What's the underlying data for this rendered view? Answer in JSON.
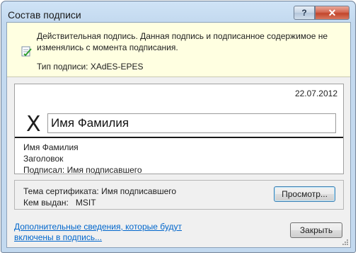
{
  "window": {
    "title": "Состав подписи",
    "help_button": "?",
    "close_button": "✕"
  },
  "info": {
    "message": "Действительная подпись. Данная подпись и подписанное содержимое не изменялись с момента подписания.",
    "signature_type": "Тип подписи: XAdES-EPES"
  },
  "signature": {
    "date": "22.07.2012",
    "x_mark": "X",
    "name_value": "Имя Фамилия",
    "signer_name": "Имя Фамилия",
    "signer_title": "Заголовок",
    "signed_by": "Подписал: Имя подписавшего"
  },
  "certificate": {
    "subject": "Тема сертификата: Имя подписавшего",
    "issued_by": "Кем выдан:   MSIT",
    "view_button": "Просмотр..."
  },
  "footer": {
    "link_text": "Дополнительные сведения, которые будут включены в подпись...",
    "close_label": "Закрыть"
  }
}
